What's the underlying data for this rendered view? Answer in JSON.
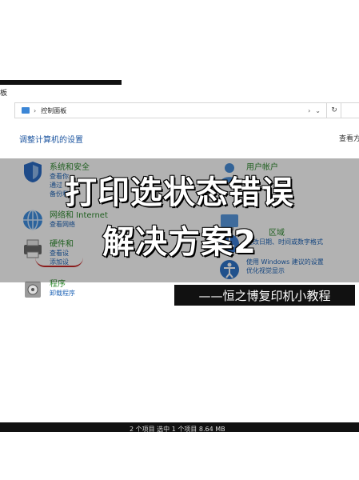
{
  "window": {
    "title": "板"
  },
  "address": {
    "path": "控制面板",
    "sep": "›",
    "dropdown": "⌄",
    "refresh": "↻"
  },
  "page": {
    "heading": "调整计算机的设置",
    "view_by": "查看方式"
  },
  "categories": {
    "system_security": {
      "title": "系统和安全",
      "links": [
        "查看你",
        "通过",
        "备份和"
      ]
    },
    "network": {
      "title": "网络和 Internet",
      "links": [
        "查看网络"
      ]
    },
    "hardware": {
      "title": "硬件和",
      "links": [
        "查看设",
        "添加设"
      ]
    },
    "programs": {
      "title": "程序",
      "links": [
        "卸载程序"
      ]
    },
    "user_accounts": {
      "title": "用户帐户"
    },
    "region": {
      "title": "区域",
      "links": [
        "更改日期、时间或数字格式"
      ]
    },
    "ease": {
      "links": [
        "使用 Windows 建议的设置",
        "优化视觉显示"
      ]
    }
  },
  "overlay": {
    "title_line1": "打印选状态错误",
    "title_line2": "解决方案2",
    "tagline": "——恒之博复印机小教程"
  },
  "status": {
    "text": "2 个项目    选中 1 个项目  8.64 MB"
  },
  "colors": {
    "link": "#1e63b6",
    "category": "#2f8a2f",
    "heading": "#1e56a0",
    "overlay_text": "#ffffff"
  }
}
